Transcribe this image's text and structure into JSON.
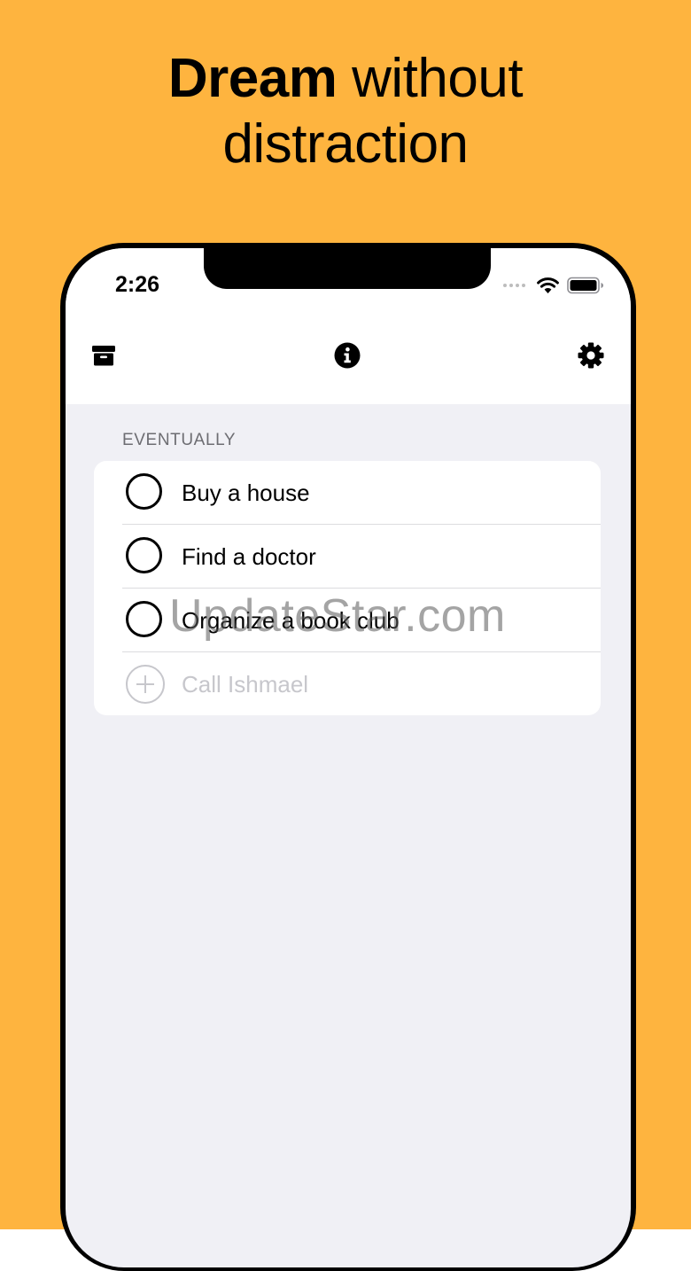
{
  "colors": {
    "background": "#FEB43F",
    "screen_background": "#F0F0F5",
    "card_background": "#FFFFFF",
    "placeholder": "#C7C7CC",
    "section_header": "#6D6D72"
  },
  "headline": {
    "bold_word": "Dream",
    "line1_rest": " without",
    "line2": "distraction"
  },
  "status_bar": {
    "time": "2:26",
    "icons": [
      "signal-dots-icon",
      "wifi-icon",
      "battery-icon"
    ]
  },
  "toolbar": {
    "left_icon": "archive-box-icon",
    "center_icon": "info-circle-icon",
    "right_icon": "gear-icon"
  },
  "list": {
    "section_title": "EVENTUALLY",
    "items": [
      {
        "label": "Buy a house",
        "checked": false
      },
      {
        "label": "Find a doctor",
        "checked": false
      },
      {
        "label": "Organize a book club",
        "checked": false
      }
    ],
    "new_item_placeholder": "Call Ishmael"
  },
  "watermark": "UpdateStar.com"
}
